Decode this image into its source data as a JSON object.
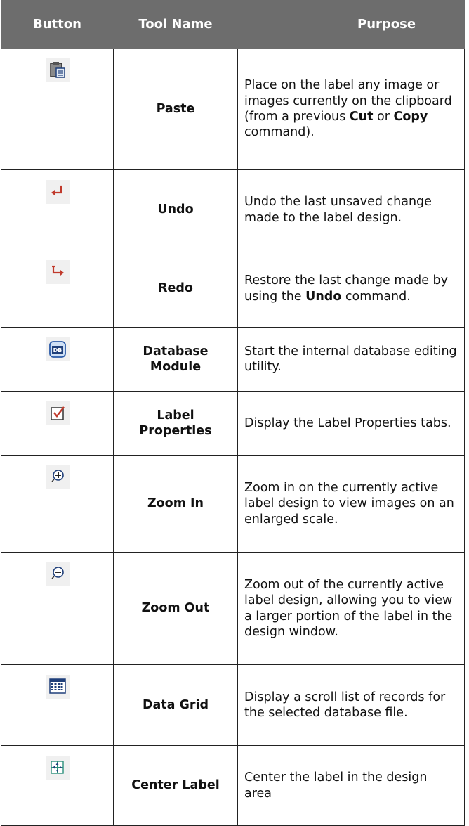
{
  "table": {
    "headers": [
      "Button",
      "Tool Name",
      "Purpose"
    ],
    "rows": [
      {
        "icon": "paste-icon",
        "tool": "Paste",
        "purpose": [
          {
            "t": "Place on the label any image or images currently on the clipboard (from a previous "
          },
          {
            "t": "Cut",
            "b": true
          },
          {
            "t": " or "
          },
          {
            "t": "Copy",
            "b": true
          },
          {
            "t": " command)."
          }
        ]
      },
      {
        "icon": "undo-icon",
        "tool": "Undo",
        "purpose": [
          {
            "t": "Undo the last unsaved change made to the label design."
          }
        ]
      },
      {
        "icon": "redo-icon",
        "tool": "Redo",
        "purpose": [
          {
            "t": "Restore the last change made by using the "
          },
          {
            "t": "Undo",
            "b": true
          },
          {
            "t": " command."
          }
        ]
      },
      {
        "icon": "database-icon",
        "tool": "Database Module",
        "purpose": [
          {
            "t": "Start the internal database editing utility."
          }
        ]
      },
      {
        "icon": "label-properties-icon",
        "tool": "Label Properties",
        "purpose": [
          {
            "t": "Display the Label Properties tabs."
          }
        ]
      },
      {
        "icon": "zoom-in-icon",
        "tool": "Zoom In",
        "purpose": [
          {
            "t": "Zoom in on the currently active label design to view images on an enlarged scale."
          }
        ]
      },
      {
        "icon": "zoom-out-icon",
        "tool": "Zoom Out",
        "purpose": [
          {
            "t": "Zoom out of the currently active label design, allowing you to view a larger portion of the label in the design window."
          }
        ]
      },
      {
        "icon": "data-grid-icon",
        "tool": "Data Grid",
        "purpose": [
          {
            "t": "Display a scroll list of records for the selected database file."
          }
        ]
      },
      {
        "icon": "center-label-icon",
        "tool": "Center Label",
        "purpose": [
          {
            "t": "Center the label in the design area"
          }
        ]
      }
    ]
  }
}
